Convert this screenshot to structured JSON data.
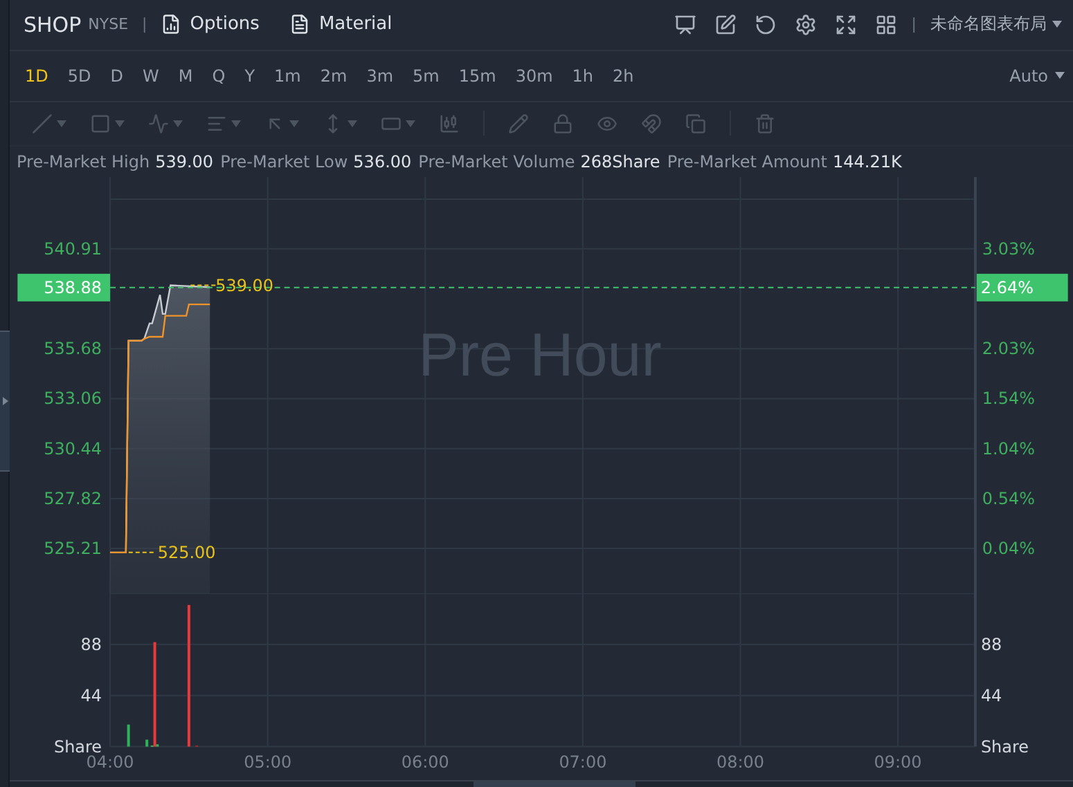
{
  "header": {
    "symbol": "SHOP",
    "exchange": "NYSE",
    "separator": "|",
    "links": [
      {
        "kind": "options",
        "label": "Options"
      },
      {
        "kind": "material",
        "label": "Material"
      }
    ],
    "layout_separator": "|",
    "layout_name": "未命名图表布局"
  },
  "timeframes": [
    {
      "label": "1D",
      "selected": true
    },
    {
      "label": "5D",
      "selected": false
    },
    {
      "label": "D",
      "selected": false
    },
    {
      "label": "W",
      "selected": false
    },
    {
      "label": "M",
      "selected": false
    },
    {
      "label": "Q",
      "selected": false
    },
    {
      "label": "Y",
      "selected": false
    },
    {
      "label": "1m",
      "selected": false
    },
    {
      "label": "2m",
      "selected": false
    },
    {
      "label": "3m",
      "selected": false
    },
    {
      "label": "5m",
      "selected": false
    },
    {
      "label": "15m",
      "selected": false
    },
    {
      "label": "30m",
      "selected": false
    },
    {
      "label": "1h",
      "selected": false
    },
    {
      "label": "2h",
      "selected": false
    }
  ],
  "scale_mode": "Auto",
  "drawing_toolbar": {
    "disabled": true
  },
  "stats": [
    {
      "label": "Pre-Market High",
      "value": "539.00"
    },
    {
      "label": "Pre-Market Low",
      "value": "536.00"
    },
    {
      "label": "Pre-Market Volume",
      "value": "268Share"
    },
    {
      "label": "Pre-Market Amount",
      "value": "144.21K"
    }
  ],
  "price_pane": {
    "watermark": "Pre Hour",
    "high_marker": "539.00",
    "low_marker": "525.00",
    "last_price": "538.88",
    "last_change": "2.64%",
    "price_ticks": [
      "540.91",
      "535.68",
      "533.06",
      "530.44",
      "527.82",
      "525.21"
    ],
    "percent_ticks": [
      "3.03%",
      "2.03%",
      "1.54%",
      "1.04%",
      "0.54%",
      "0.04%"
    ]
  },
  "volume_pane": {
    "left_ticks": [
      "88",
      "44"
    ],
    "left_unit": "Share",
    "right_ticks": [
      "88",
      "44"
    ],
    "right_unit": "Share"
  },
  "time_ticks": [
    "04:00",
    "05:00",
    "06:00",
    "07:00",
    "08:00",
    "09:00"
  ]
}
